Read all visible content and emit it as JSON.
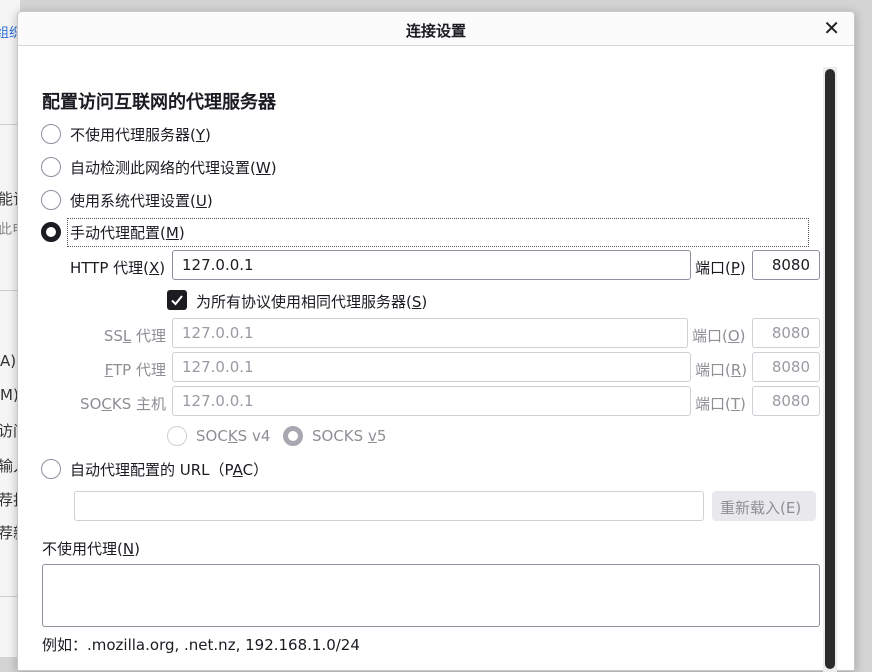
{
  "background": {
    "fragments": [
      "组织",
      "能记",
      "此电",
      "A)",
      "M)",
      "访问",
      "输入",
      "荐扫",
      "荐新"
    ]
  },
  "dialog": {
    "title": "连接设置",
    "close_icon": "close-icon",
    "heading": "配置访问互联网的代理服务器",
    "options": [
      {
        "pre": "不使用代理服务器(",
        "key": "Y",
        "post": ")",
        "checked": false
      },
      {
        "pre": "自动检测此网络的代理设置(",
        "key": "W",
        "post": ")",
        "checked": false
      },
      {
        "pre": "使用系统代理设置(",
        "key": "U",
        "post": ")",
        "checked": false
      },
      {
        "pre": "手动代理配置(",
        "key": "M",
        "post": ")",
        "checked": true
      }
    ],
    "http": {
      "pre": "HTTP 代理(",
      "key": "X",
      "post": ")",
      "value": "127.0.0.1",
      "port_pre": "端口(",
      "port_key": "P",
      "port_post": ")",
      "port": "8080"
    },
    "same_proxy": {
      "pre": "为所有协议使用相同代理服务器(",
      "key": "S",
      "post": ")",
      "checked": true
    },
    "ssl": {
      "pre": "SS",
      "key": "L",
      "post": " 代理",
      "value": "127.0.0.1",
      "port_pre": "端口(",
      "port_key": "O",
      "port_post": ")",
      "port": "8080"
    },
    "ftp": {
      "pre": "",
      "key": "F",
      "post": "TP 代理",
      "value": "127.0.0.1",
      "port_pre": "端口(",
      "port_key": "R",
      "port_post": ")",
      "port": "8080"
    },
    "socks": {
      "pre": "SO",
      "key": "C",
      "post": "KS 主机",
      "value": "127.0.0.1",
      "port_pre": "端口(",
      "port_key": "T",
      "port_post": ")",
      "port": "8080"
    },
    "socks_v4": {
      "pre": "SOC",
      "key": "K",
      "post": "S v4",
      "checked": false
    },
    "socks_v5": {
      "pre": "SOCKS ",
      "key": "v",
      "post": "5",
      "checked": true
    },
    "pac": {
      "pre": "自动代理配置的 URL（P",
      "key": "A",
      "post": "C）",
      "value": "",
      "reload_label": "重新载入(E)"
    },
    "no_proxy": {
      "pre": "不使用代理(",
      "key": "N",
      "post": ")",
      "value": ""
    },
    "example": "例如：.mozilla.org, .net.nz, 192.168.1.0/24"
  }
}
